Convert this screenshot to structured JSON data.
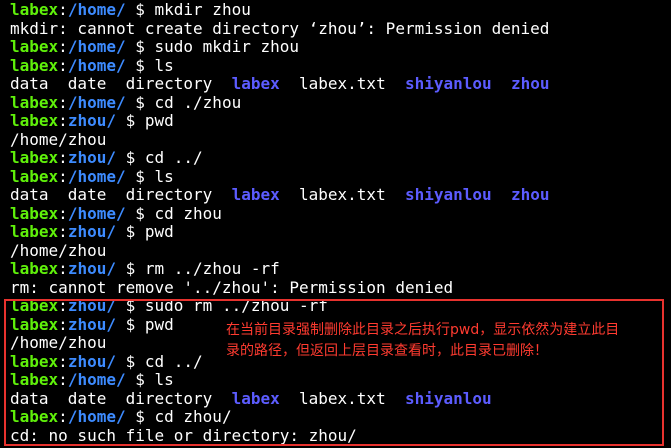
{
  "colors": {
    "background": "#000000",
    "text": "#ffffff",
    "prompt_user": "#5ff00a",
    "prompt_path": "#3d8bff",
    "directory": "#5c5cff",
    "highlight_border": "#e8322e",
    "annotation_text": "#ff3b30"
  },
  "terminal": {
    "lines": [
      [
        {
          "t": "labex",
          "k": "user"
        },
        {
          "t": ":",
          "k": "plain"
        },
        {
          "t": "/home/",
          "k": "path"
        },
        {
          "t": " $ mkdir zhou",
          "k": "plain"
        }
      ],
      [
        {
          "t": "mkdir: cannot create directory ‘zhou’: Permission denied",
          "k": "plain"
        }
      ],
      [
        {
          "t": "labex",
          "k": "user"
        },
        {
          "t": ":",
          "k": "plain"
        },
        {
          "t": "/home/",
          "k": "path"
        },
        {
          "t": " $ sudo mkdir zhou",
          "k": "plain"
        }
      ],
      [
        {
          "t": "labex",
          "k": "user"
        },
        {
          "t": ":",
          "k": "plain"
        },
        {
          "t": "/home/",
          "k": "path"
        },
        {
          "t": " $ ls",
          "k": "plain"
        }
      ],
      [
        {
          "t": "data  date  directory  ",
          "k": "plain"
        },
        {
          "t": "labex",
          "k": "dir"
        },
        {
          "t": "  labex.txt  ",
          "k": "plain"
        },
        {
          "t": "shiyanlou",
          "k": "dir"
        },
        {
          "t": "  ",
          "k": "plain"
        },
        {
          "t": "zhou",
          "k": "dir"
        }
      ],
      [
        {
          "t": "labex",
          "k": "user"
        },
        {
          "t": ":",
          "k": "plain"
        },
        {
          "t": "/home/",
          "k": "path"
        },
        {
          "t": " $ cd ./zhou",
          "k": "plain"
        }
      ],
      [
        {
          "t": "labex",
          "k": "user"
        },
        {
          "t": ":",
          "k": "plain"
        },
        {
          "t": "zhou/",
          "k": "path"
        },
        {
          "t": " $ pwd",
          "k": "plain"
        }
      ],
      [
        {
          "t": "/home/zhou",
          "k": "plain"
        }
      ],
      [
        {
          "t": "labex",
          "k": "user"
        },
        {
          "t": ":",
          "k": "plain"
        },
        {
          "t": "zhou/",
          "k": "path"
        },
        {
          "t": " $ cd ../",
          "k": "plain"
        }
      ],
      [
        {
          "t": "labex",
          "k": "user"
        },
        {
          "t": ":",
          "k": "plain"
        },
        {
          "t": "/home/",
          "k": "path"
        },
        {
          "t": " $ ls",
          "k": "plain"
        }
      ],
      [
        {
          "t": "data  date  directory  ",
          "k": "plain"
        },
        {
          "t": "labex",
          "k": "dir"
        },
        {
          "t": "  labex.txt  ",
          "k": "plain"
        },
        {
          "t": "shiyanlou",
          "k": "dir"
        },
        {
          "t": "  ",
          "k": "plain"
        },
        {
          "t": "zhou",
          "k": "dir"
        }
      ],
      [
        {
          "t": "labex",
          "k": "user"
        },
        {
          "t": ":",
          "k": "plain"
        },
        {
          "t": "/home/",
          "k": "path"
        },
        {
          "t": " $ cd zhou",
          "k": "plain"
        }
      ],
      [
        {
          "t": "labex",
          "k": "user"
        },
        {
          "t": ":",
          "k": "plain"
        },
        {
          "t": "zhou/",
          "k": "path"
        },
        {
          "t": " $ pwd",
          "k": "plain"
        }
      ],
      [
        {
          "t": "/home/zhou",
          "k": "plain"
        }
      ],
      [
        {
          "t": "labex",
          "k": "user"
        },
        {
          "t": ":",
          "k": "plain"
        },
        {
          "t": "zhou/",
          "k": "path"
        },
        {
          "t": " $ rm ../zhou -rf",
          "k": "plain"
        }
      ],
      [
        {
          "t": "rm: cannot remove '../zhou': Permission denied",
          "k": "plain"
        }
      ],
      [
        {
          "t": "labex",
          "k": "user"
        },
        {
          "t": ":",
          "k": "plain"
        },
        {
          "t": "zhou/",
          "k": "path"
        },
        {
          "t": " $ sudo rm ../zhou -rf",
          "k": "plain"
        }
      ],
      [
        {
          "t": "labex",
          "k": "user"
        },
        {
          "t": ":",
          "k": "plain"
        },
        {
          "t": "zhou/",
          "k": "path"
        },
        {
          "t": " $ pwd",
          "k": "plain"
        }
      ],
      [
        {
          "t": "/home/zhou",
          "k": "plain"
        }
      ],
      [
        {
          "t": "labex",
          "k": "user"
        },
        {
          "t": ":",
          "k": "plain"
        },
        {
          "t": "zhou/",
          "k": "path"
        },
        {
          "t": " $ cd ../",
          "k": "plain"
        }
      ],
      [
        {
          "t": "labex",
          "k": "user"
        },
        {
          "t": ":",
          "k": "plain"
        },
        {
          "t": "/home/",
          "k": "path"
        },
        {
          "t": " $ ls",
          "k": "plain"
        }
      ],
      [
        {
          "t": "data  date  directory  ",
          "k": "plain"
        },
        {
          "t": "labex",
          "k": "dir"
        },
        {
          "t": "  labex.txt  ",
          "k": "plain"
        },
        {
          "t": "shiyanlou",
          "k": "dir"
        }
      ],
      [
        {
          "t": "labex",
          "k": "user"
        },
        {
          "t": ":",
          "k": "plain"
        },
        {
          "t": "/home/",
          "k": "path"
        },
        {
          "t": " $ cd zhou/",
          "k": "plain"
        }
      ],
      [
        {
          "t": "cd: no such file or directory: zhou/",
          "k": "plain"
        }
      ]
    ]
  },
  "annotation": {
    "lines": [
      "在当前目录强制删除此目录之后执行pwd，显示依然为建立此目",
      "录的路径，但返回上层目录查看时，此目录已删除！"
    ]
  }
}
